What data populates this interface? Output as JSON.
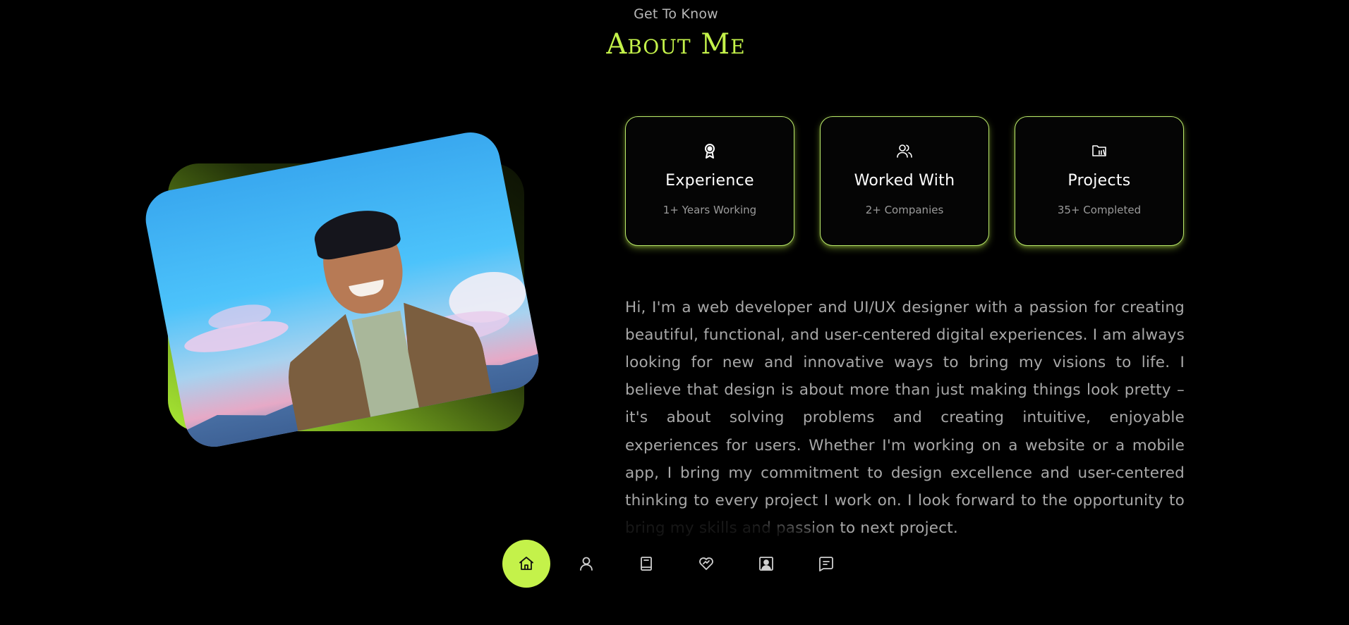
{
  "header": {
    "eyebrow": "Get To Know",
    "title": "About Me"
  },
  "colors": {
    "accent": "#c4f24a",
    "background": "#000000",
    "text_muted": "#a8a8a8"
  },
  "stats": [
    {
      "icon": "award-icon",
      "title": "Experience",
      "subtitle": "1+ Years Working"
    },
    {
      "icon": "users-icon",
      "title": "Worked With",
      "subtitle": "2+ Companies"
    },
    {
      "icon": "folder-icon",
      "title": "Projects",
      "subtitle": "35+ Completed"
    }
  ],
  "bio": "Hi, I'm a web developer and UI/UX designer with a passion for creating beautiful, functional, and user-centered digital experiences. I am always looking for new and innovative ways to bring my visions to life. I believe that design is about more than just making things look pretty – it's about solving problems and creating intuitive, enjoyable experiences for users. Whether I'm working on a website or a mobile app, I bring my commitment to design excellence and user-centered thinking to every project I work on. I look forward to the opportunity to bring my skills and passion to next project.",
  "nav": [
    {
      "icon": "home-icon",
      "active": true
    },
    {
      "icon": "user-icon",
      "active": false
    },
    {
      "icon": "book-icon",
      "active": false
    },
    {
      "icon": "handshake-icon",
      "active": false
    },
    {
      "icon": "portfolio-icon",
      "active": false
    },
    {
      "icon": "message-icon",
      "active": false
    }
  ]
}
